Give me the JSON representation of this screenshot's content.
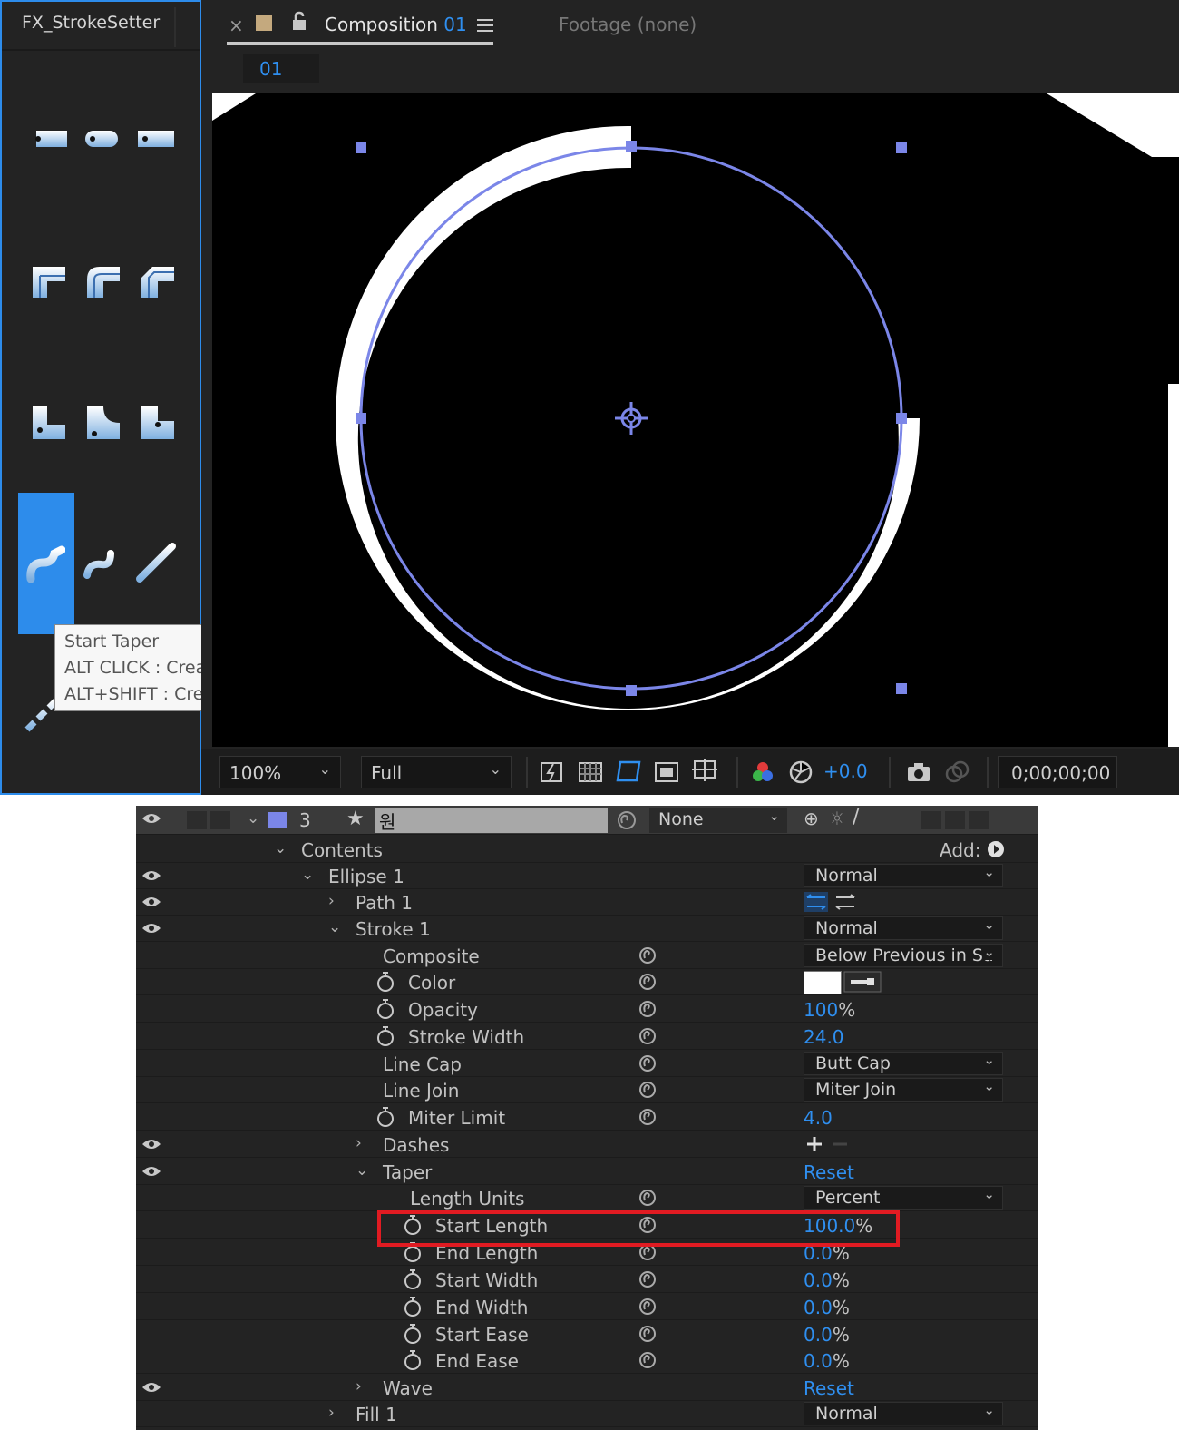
{
  "left_panel": {
    "title": "FX_StrokeSetter",
    "tools": [
      {
        "row": 1,
        "icons": [
          "round-cap-icon",
          "round-cap-icon",
          "butt-cap-icon"
        ]
      },
      {
        "row": 2,
        "icons": [
          "miter-join-icon",
          "round-join-icon",
          "bevel-join-icon"
        ]
      },
      {
        "row": 3,
        "icons": [
          "corner-icon",
          "corner-icon",
          "corner-icon"
        ]
      },
      {
        "row": 4,
        "icons": [
          "start-taper-icon",
          "end-taper-icon",
          "both-taper-icon"
        ]
      }
    ],
    "tooltip": {
      "line1": "Start Taper",
      "line2": "ALT CLICK : Create local controlers",
      "line3": "ALT+SHIFT : Create global controlers"
    }
  },
  "composition": {
    "tab_close": "×",
    "tab_label": "Composition",
    "tab_number": "01",
    "footage_tab": "Footage",
    "footage_value": "(none)",
    "breadcrumb": "01",
    "toolbar": {
      "zoom": "100%",
      "resolution": "Full",
      "exposure": "+0.0",
      "timecode": "0;00;00;00"
    }
  },
  "timeline": {
    "layer": {
      "number": "3",
      "name": "원",
      "parent": "None"
    },
    "contents_label": "Contents",
    "add_label": "Add:",
    "rows": {
      "ellipse": {
        "label": "Ellipse 1",
        "blend": "Normal"
      },
      "path": {
        "label": "Path 1"
      },
      "stroke": {
        "label": "Stroke 1",
        "blend": "Normal"
      },
      "composite": {
        "label": "Composite",
        "value": "Below Previous in Sa"
      },
      "color": {
        "label": "Color"
      },
      "opacity": {
        "label": "Opacity",
        "value": "100",
        "unit": "%"
      },
      "stroke_width": {
        "label": "Stroke Width",
        "value": "24.0"
      },
      "line_cap": {
        "label": "Line Cap",
        "value": "Butt Cap"
      },
      "line_join": {
        "label": "Line Join",
        "value": "Miter Join"
      },
      "miter_limit": {
        "label": "Miter Limit",
        "value": "4.0"
      },
      "dashes": {
        "label": "Dashes"
      },
      "taper": {
        "label": "Taper",
        "reset": "Reset"
      },
      "length_units": {
        "label": "Length Units",
        "value": "Percent"
      },
      "start_length": {
        "label": "Start Length",
        "value": "100.0",
        "unit": "%"
      },
      "end_length": {
        "label": "End Length",
        "value": "0.0",
        "unit": "%"
      },
      "start_width": {
        "label": "Start Width",
        "value": "0.0",
        "unit": "%"
      },
      "end_width": {
        "label": "End Width",
        "value": "0.0",
        "unit": "%"
      },
      "start_ease": {
        "label": "Start Ease",
        "value": "0.0",
        "unit": "%"
      },
      "end_ease": {
        "label": "End Ease",
        "value": "0.0",
        "unit": "%"
      },
      "wave": {
        "label": "Wave",
        "reset": "Reset"
      },
      "fill": {
        "label": "Fill 1",
        "blend": "Normal"
      }
    }
  },
  "colors": {
    "accent": "#2d8ceb",
    "value_blue": "#2f8ff0",
    "highlight_red": "#e11b22",
    "path_blue": "#7b86e8"
  }
}
